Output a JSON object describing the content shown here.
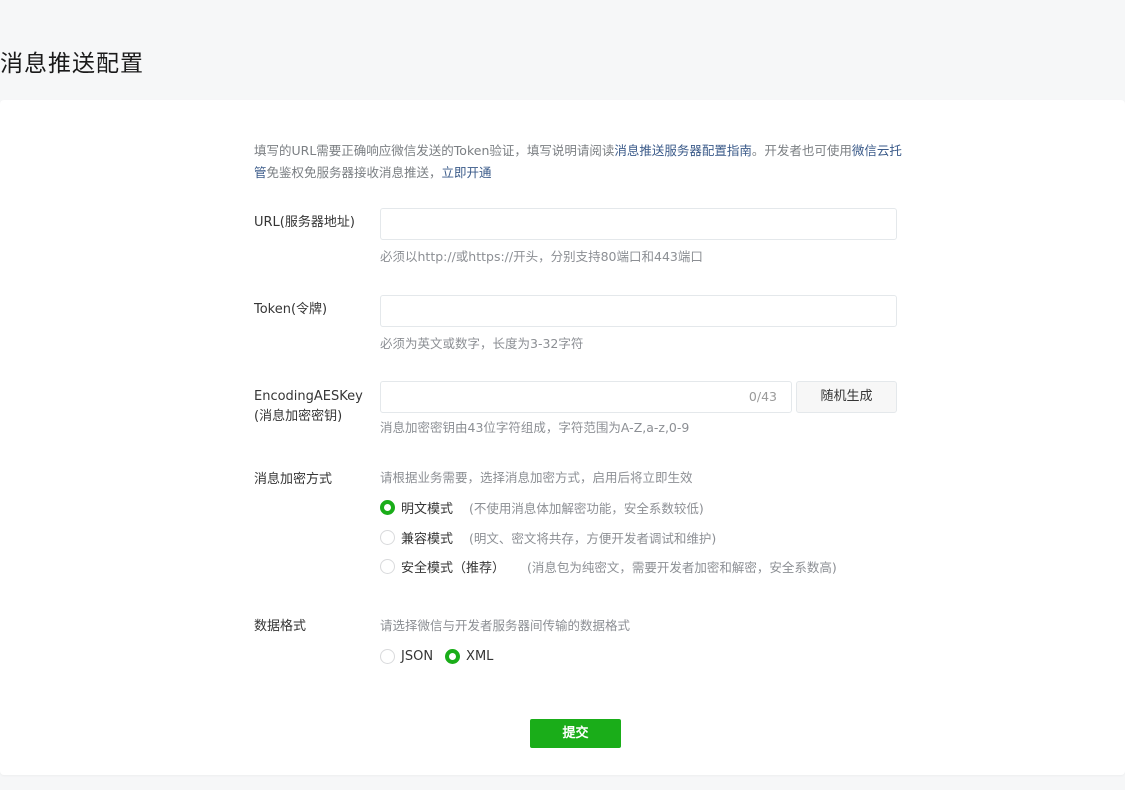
{
  "page": {
    "title": "消息推送配置"
  },
  "intro": {
    "text1": "填写的URL需要正确响应微信发送的Token验证，填写说明请阅读",
    "link1": "消息推送服务器配置指南",
    "text2": "。开发者也可使用",
    "link2": "微信云托管",
    "text3": "免鉴权免服务器接收消息推送，",
    "link3": "立即开通"
  },
  "url_field": {
    "label": "URL(服务器地址)",
    "value": "",
    "placeholder": "",
    "hint": "必须以http://或https://开头，分别支持80端口和443端口"
  },
  "token_field": {
    "label": "Token(令牌)",
    "value": "",
    "placeholder": "",
    "hint": "必须为英文或数字，长度为3-32字符"
  },
  "aes_field": {
    "label_line1": "EncodingAESKey",
    "label_line2": "(消息加密密钥)",
    "value": "",
    "counter": "0/43",
    "generate_button": "随机生成",
    "hint": "消息加密密钥由43位字符组成，字符范围为A-Z,a-z,0-9"
  },
  "encryption": {
    "label": "消息加密方式",
    "hint": "请根据业务需要，选择消息加密方式，启用后将立即生效",
    "options": [
      {
        "label": "明文模式",
        "desc": "(不使用消息体加解密功能，安全系数较低)",
        "checked": true
      },
      {
        "label": "兼容模式",
        "desc": "(明文、密文将共存，方便开发者调试和维护)",
        "checked": false
      },
      {
        "label": "安全模式（推荐）",
        "desc": "(消息包为纯密文，需要开发者加密和解密，安全系数高)",
        "checked": false
      }
    ]
  },
  "data_format": {
    "label": "数据格式",
    "hint": "请选择微信与开发者服务器间传输的数据格式",
    "options": [
      {
        "label": "JSON",
        "checked": false
      },
      {
        "label": "XML",
        "checked": true
      }
    ]
  },
  "submit_button": "提交",
  "colors": {
    "accent": "#1aad19",
    "link": "#3a5a89"
  }
}
